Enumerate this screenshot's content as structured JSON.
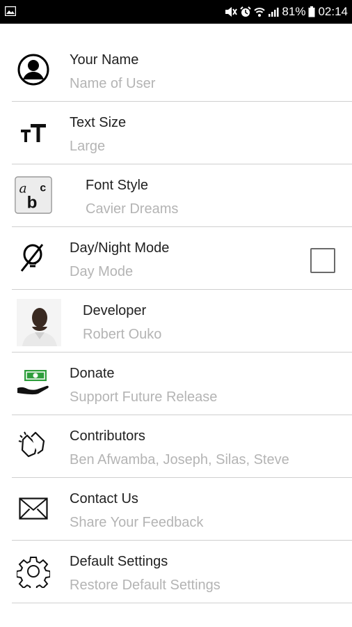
{
  "status_bar": {
    "battery": "81%",
    "time": "02:14",
    "left_icon": "image-notification-icon",
    "icons": [
      "mute-icon",
      "alarm-icon",
      "wifi-icon",
      "signal-icon",
      "battery-icon"
    ]
  },
  "settings": [
    {
      "title": "Your Name",
      "subtitle": "Name of User",
      "icon": "user-icon"
    },
    {
      "title": "Text Size",
      "subtitle": "Large",
      "icon": "text-size-icon"
    },
    {
      "title": "Font Style",
      "subtitle": "Cavier Dreams",
      "icon": "font-style-icon",
      "icon_text": "abc"
    },
    {
      "title": "Day/Night Mode",
      "subtitle": "Day Mode",
      "icon": "day-night-icon",
      "checked": false
    },
    {
      "title": "Developer",
      "subtitle": "Robert Ouko",
      "icon": "developer-photo"
    },
    {
      "title": "Donate",
      "subtitle": "Support Future Release",
      "icon": "donate-icon"
    },
    {
      "title": "Contributors",
      "subtitle": "Ben Afwamba, Joseph, Silas, Steve",
      "icon": "clapping-hands-icon"
    },
    {
      "title": "Contact Us",
      "subtitle": "Share Your Feedback",
      "icon": "envelope-icon"
    },
    {
      "title": "Default Settings",
      "subtitle": "Restore Default Settings",
      "icon": "gear-icon"
    }
  ],
  "colors": {
    "title": "#212121",
    "subtitle": "#b4b4b4",
    "divider": "#cfcfcf",
    "donate_green": "#2e9e3c"
  }
}
